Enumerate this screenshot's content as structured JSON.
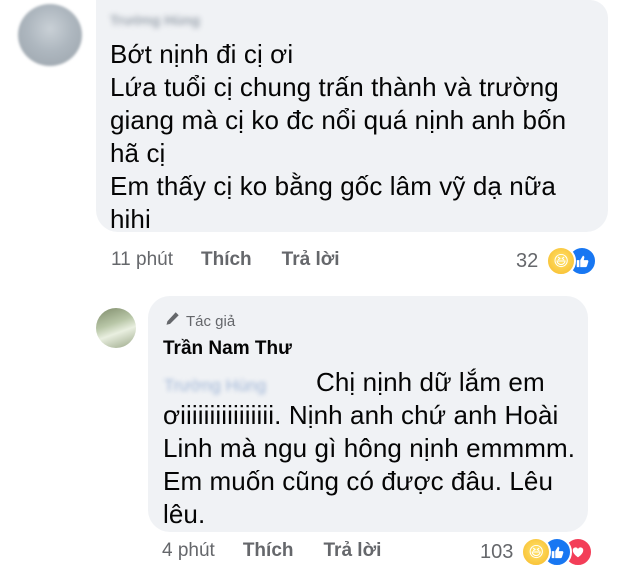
{
  "comment1": {
    "author_name": "Trường Hùng",
    "text": "Bớt nịnh đi cị ơi\nLứa tuổi cị chung trấn thành và trường\ngiang mà cị ko đc nổi quá nịnh anh bốn\nhã cị\nEm thấy cị ko bằng gốc lâm vỹ dạ nữa\nhihi",
    "time": "11 phút",
    "like_label": "Thích",
    "reply_label": "Trả lời",
    "reaction_count": "32"
  },
  "reply": {
    "author_tag": "Tác giả",
    "author_name": "Trần Nam Thư",
    "mention": "Trường Hùng",
    "text": "Chị nịnh dữ lắm em\nơiiiiiiiiiiiiiiii. Nịnh anh chứ anh Hoài\nLinh mà ngu gì hông nịnh emmmm.\nEm muốn cũng có được đâu. Lêu\nlêu.",
    "time": "4 phút",
    "like_label": "Thích",
    "reply_label": "Trả lời",
    "reaction_count": "103"
  },
  "icons": {
    "haha": "haha-reaction-icon",
    "like": "like-reaction-icon",
    "love": "love-reaction-icon",
    "pen": "pen-icon"
  },
  "colors": {
    "bubble": "#f0f2f5",
    "meta": "#65676b",
    "like_blue": "#1877f2",
    "love_red": "#f33e58",
    "haha_yellow": "#f7b928"
  }
}
